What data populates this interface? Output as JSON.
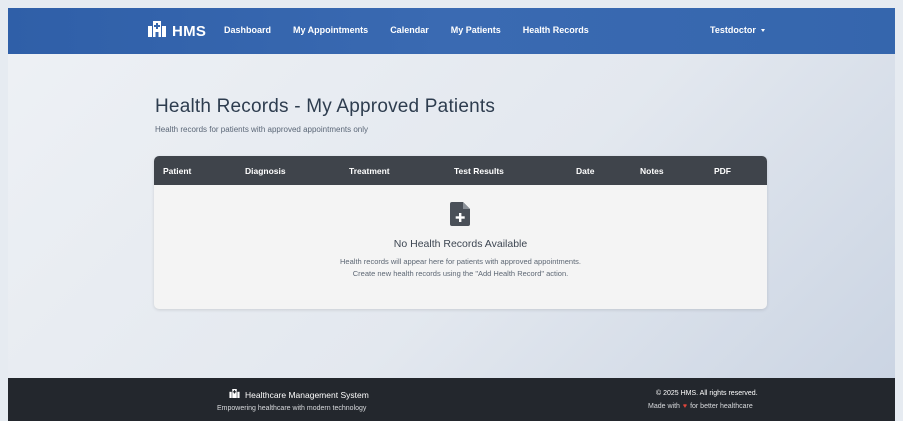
{
  "navbar": {
    "brand": "HMS",
    "links": [
      "Dashboard",
      "My Appointments",
      "Calendar",
      "My Patients",
      "Health Records"
    ],
    "user": "Testdoctor"
  },
  "page": {
    "title": "Health Records - My Approved Patients",
    "subtitle": "Health records for patients with approved appointments only"
  },
  "table": {
    "columns": [
      "Patient",
      "Diagnosis",
      "Treatment",
      "Test Results",
      "Date",
      "Notes",
      "PDF"
    ],
    "empty": {
      "icon": "file-medical-icon",
      "title": "No Health Records Available",
      "line1": "Health records will appear here for patients with approved appointments.",
      "line2": "Create new health records using the \"Add Health Record\" action."
    }
  },
  "footer": {
    "brand": "Healthcare Management System",
    "tagline": "Empowering healthcare with modern technology",
    "copyright": "© 2025 HMS. All rights reserved.",
    "made_prefix": "Made with",
    "made_suffix": "for better healthcare"
  },
  "colors": {
    "navbar": "#3566ad",
    "table_header": "#3f444b",
    "footer": "#23272d",
    "heart": "#e0453a"
  }
}
